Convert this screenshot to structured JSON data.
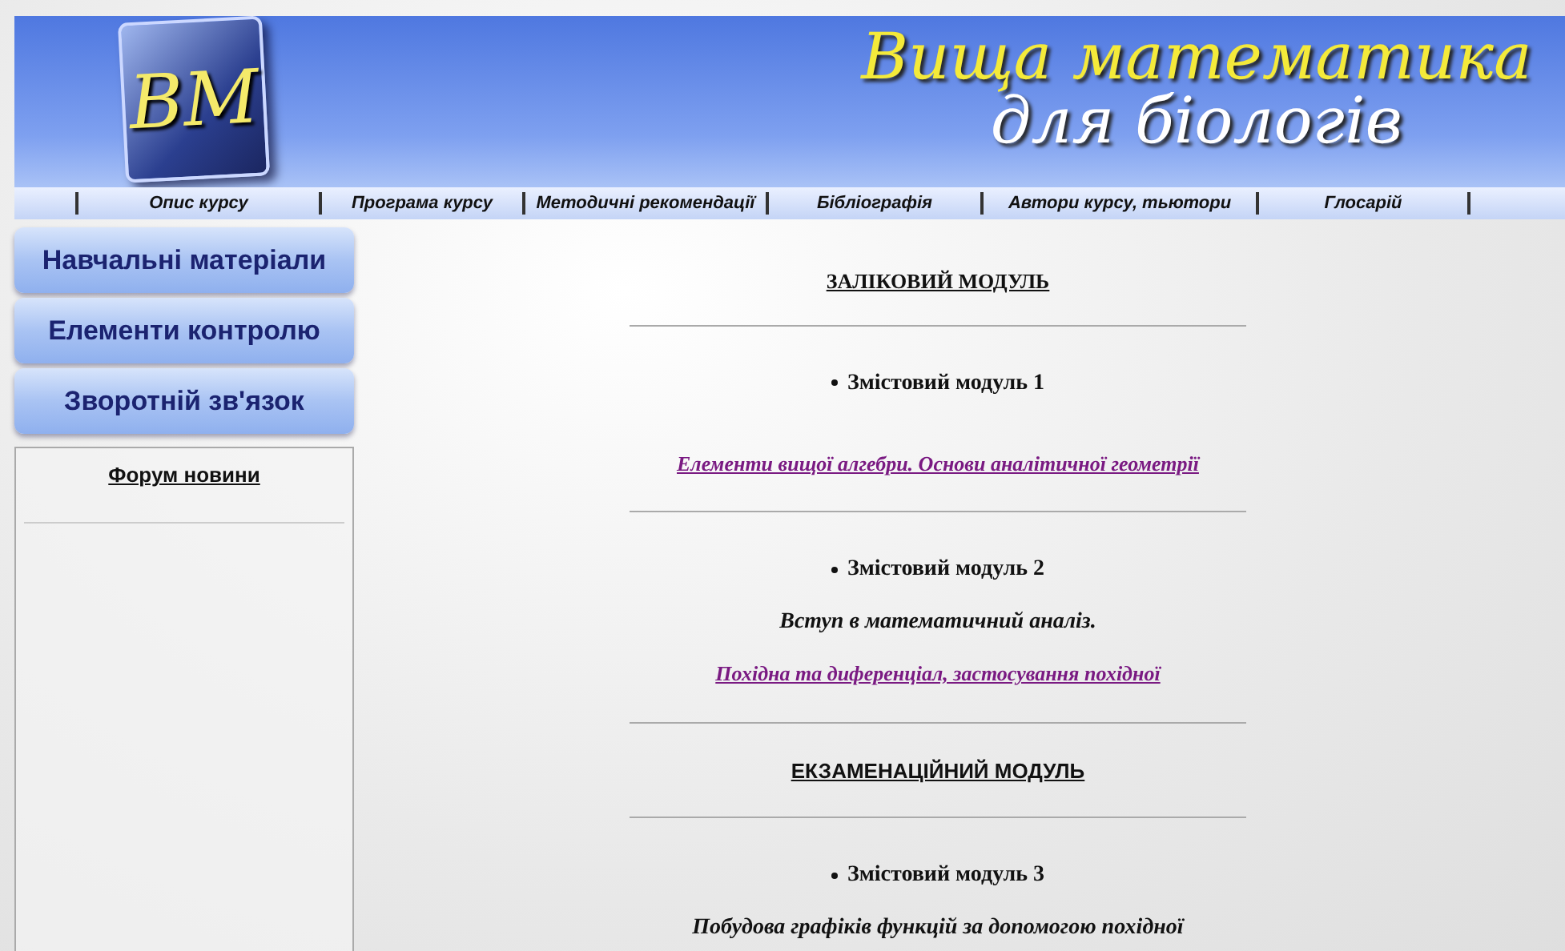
{
  "banner": {
    "logo": "ВМ",
    "title_line_1": "Вища математика",
    "title_line_2": "для біологів"
  },
  "nav": [
    "Опис курсу",
    "Програма курсу",
    "Методичні рекомендації",
    "Бібліографія",
    "Автори курсу, тьютори",
    "Глосарій"
  ],
  "sidebar": {
    "buttons": [
      "Навчальні матеріали",
      "Елементи контролю",
      "Зворотній зв'язок"
    ],
    "forum": {
      "title": "Форум новини"
    }
  },
  "content": [
    {
      "kind": "heading",
      "text": "ЗАЛІКОВИЙ МОДУЛЬ"
    },
    {
      "kind": "rule"
    },
    {
      "kind": "bullet",
      "text": "Змістовий модуль 1"
    },
    {
      "kind": "link",
      "text": "Елементи вищої алгебри. Основи аналітичної геометрії"
    },
    {
      "kind": "rule"
    },
    {
      "kind": "bullet",
      "text": "Змістовий модуль 2"
    },
    {
      "kind": "text",
      "text": "Вступ в математичний аналіз."
    },
    {
      "kind": "link",
      "text": "Похідна та диференціал, застосування похідної"
    },
    {
      "kind": "rule"
    },
    {
      "kind": "heading_sans",
      "text": "ЕКЗАМЕНАЦІЙНИЙ МОДУЛЬ"
    },
    {
      "kind": "rule"
    },
    {
      "kind": "bullet",
      "text": "Змістовий модуль 3"
    },
    {
      "kind": "text",
      "text": "Побудова графіків функцій за допомогою похідної"
    }
  ]
}
